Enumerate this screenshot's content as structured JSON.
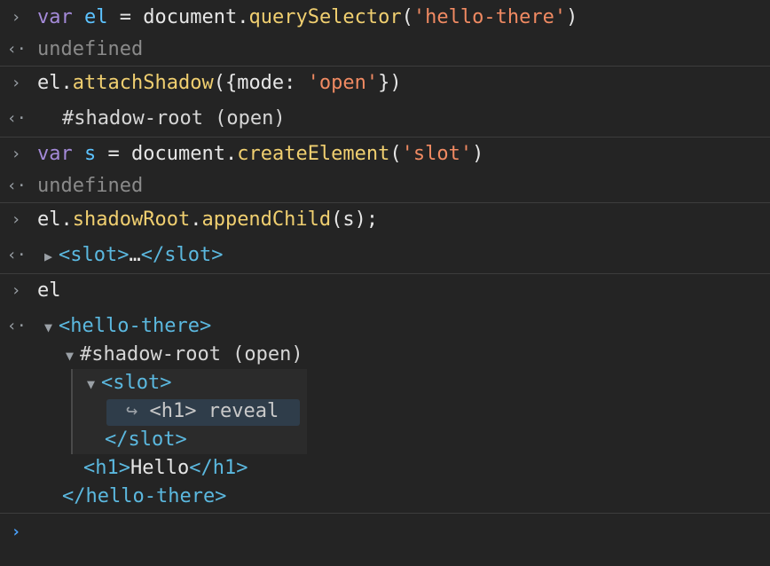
{
  "prompts": {
    "input": "›",
    "output": "‹·"
  },
  "entries": [
    {
      "input": {
        "kw": "var",
        "id": "el",
        "eq": " = ",
        "obj": "document.",
        "fn": "querySelector",
        "open": "(",
        "str": "'hello-there'",
        "close": ")"
      },
      "output": "undefined"
    },
    {
      "input": {
        "obj": "el.",
        "fn": "attachShadow",
        "open": "({mode: ",
        "str": "'open'",
        "close": "})"
      },
      "output": "#shadow-root (open)"
    },
    {
      "input": {
        "kw": "var",
        "id": "s",
        "eq": " = ",
        "obj": "document.",
        "fn": "createElement",
        "open": "(",
        "str": "'slot'",
        "close": ")"
      },
      "output": "undefined"
    },
    {
      "input": {
        "obj": "el.",
        "fn1": "shadowRoot",
        "dot": ".",
        "fn": "appendChild",
        "open": "(s);"
      },
      "output": {
        "open_tag": "<slot>",
        "ellipsis": "…",
        "close_tag": "</slot>"
      }
    },
    {
      "input": {
        "obj": "el"
      },
      "output": {
        "root_open": "<hello-there>",
        "shadow_root": "#shadow-root (open)",
        "slot_open": "<slot>",
        "reveal_arrow": "↪",
        "reveal_text": "<h1> reveal",
        "slot_close": "</slot>",
        "h1_open": "<h1>",
        "h1_text": "Hello",
        "h1_close": "</h1>",
        "root_close": "</hello-there>"
      }
    }
  ],
  "colors": {
    "background": "#242424",
    "keyword": "#a48ad8",
    "identifier": "#5cc3ff",
    "function": "#f0cf70",
    "string": "#f08a62",
    "tag": "#5bb8df",
    "prompt_active": "#4aa3ff"
  }
}
